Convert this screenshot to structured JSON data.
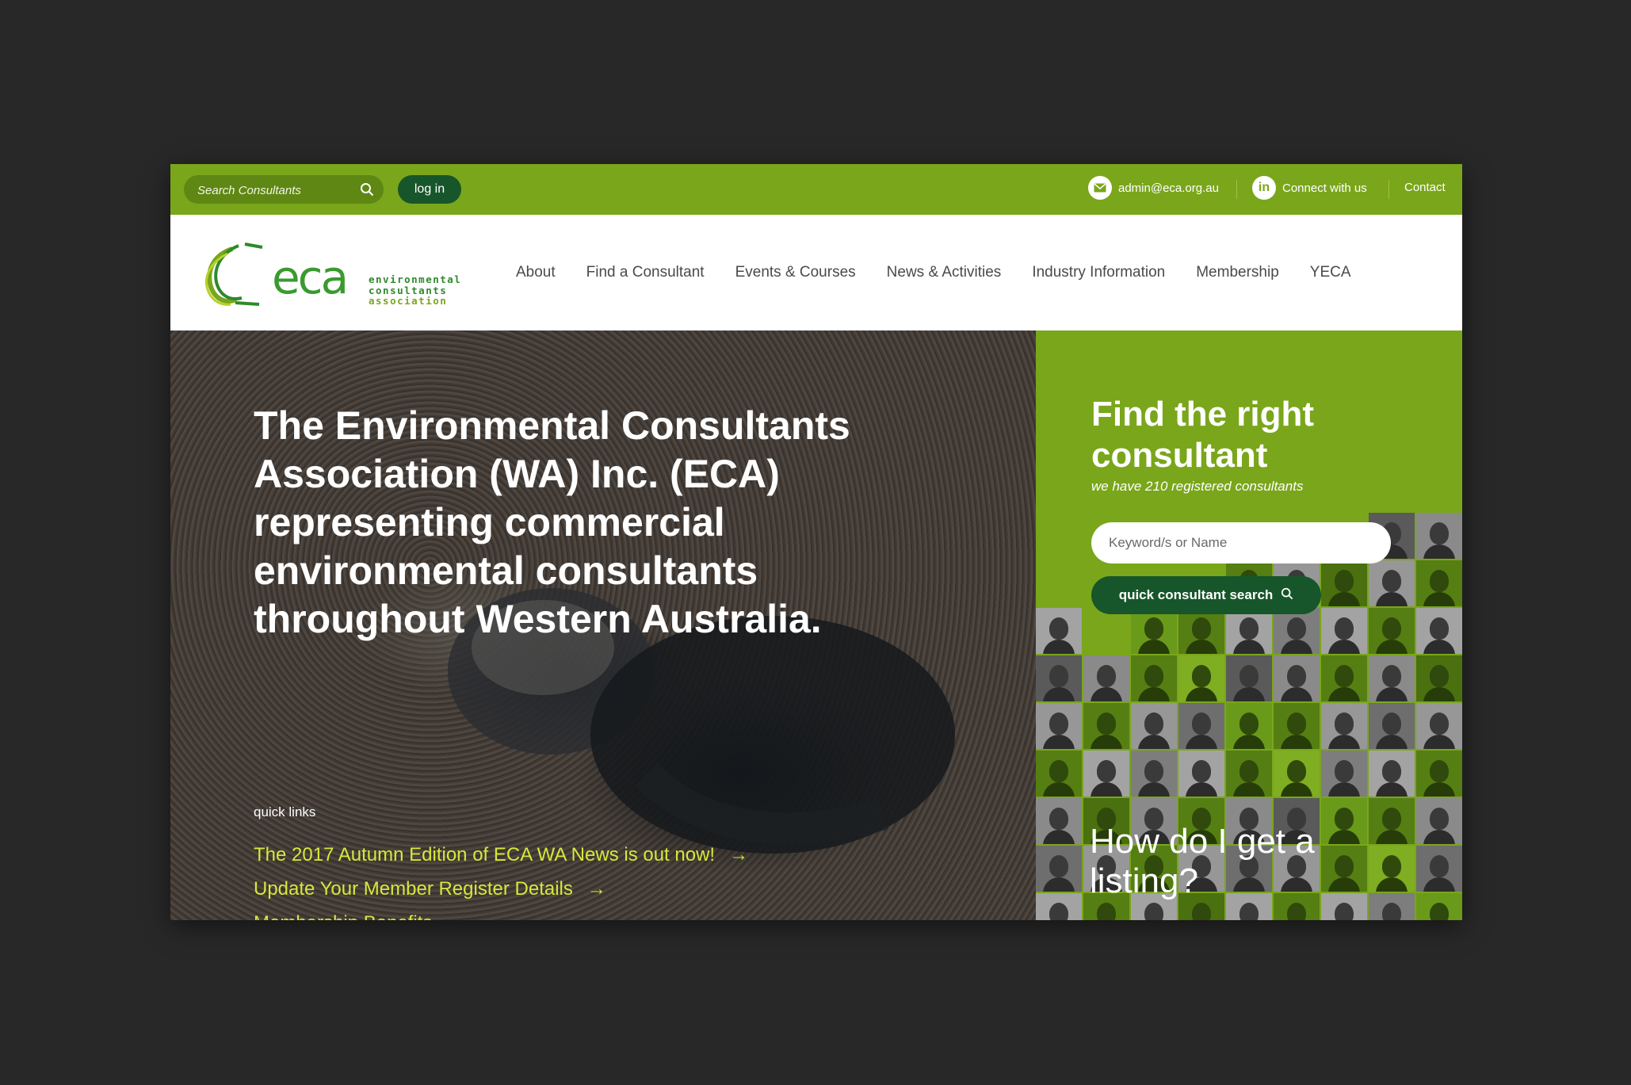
{
  "topbar": {
    "search_placeholder": "Search Consultants",
    "login_label": "log in",
    "email": "admin@eca.org.au",
    "linkedin_label": "Connect with us",
    "contact_label": "Contact"
  },
  "logo": {
    "word": "eca",
    "tagline": [
      "environmental",
      "consultants",
      "association"
    ]
  },
  "nav": {
    "items": [
      "About",
      "Find a Consultant",
      "Events & Courses",
      "News & Activities",
      "Industry Information",
      "Membership",
      "YECA"
    ]
  },
  "hero": {
    "title": "The Environmental Consultants Association (WA) Inc. (ECA) representing commercial environmental consultants throughout Western Australia.",
    "quick_links_label": "quick links",
    "quick_links": [
      "The 2017 Autumn Edition of ECA WA News is out now!",
      "Update Your Member Register Details",
      "Membership Benefits"
    ]
  },
  "finder": {
    "title": "Find the right consultant",
    "subtitle": "we have 210 registered consultants",
    "input_placeholder": "Keyword/s or Name",
    "button_label": "quick consultant search",
    "listing_title": "How do I get a listing?"
  },
  "colors": {
    "brand_green": "#7aa61b",
    "dark_green": "#17562a",
    "link_yellow": "#d8e73a",
    "page_background": "#282828"
  },
  "icons": [
    "search-icon",
    "envelope-icon",
    "linkedin-icon",
    "arrow-right-icon",
    "turtle-photo"
  ]
}
